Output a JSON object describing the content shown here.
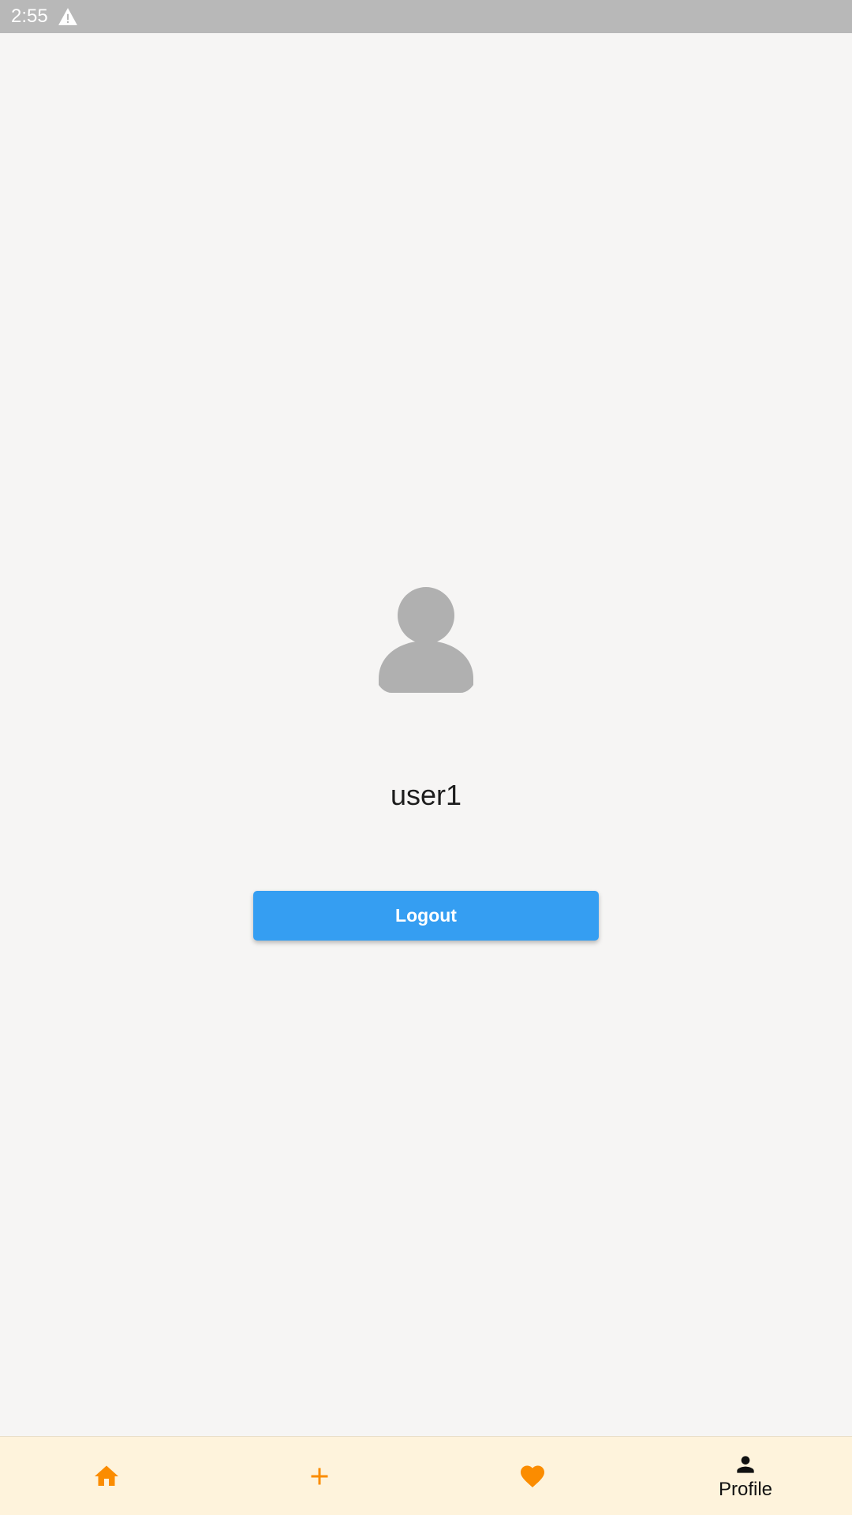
{
  "status_bar": {
    "time": "2:55",
    "warning_icon": "warning-icon"
  },
  "profile": {
    "avatar_icon": "person-icon",
    "username": "user1",
    "logout_label": "Logout"
  },
  "bottom_nav": {
    "items": [
      {
        "icon": "home-icon",
        "label": "",
        "active": false
      },
      {
        "icon": "plus-icon",
        "label": "",
        "active": false
      },
      {
        "icon": "heart-icon",
        "label": "",
        "active": false
      },
      {
        "icon": "person-icon",
        "label": "Profile",
        "active": true
      }
    ]
  },
  "colors": {
    "accent": "#fb8c00",
    "button": "#359ef2",
    "nav_background": "#fef3dc",
    "status_bar": "#b8b8b8",
    "avatar": "#b0b0b0"
  }
}
